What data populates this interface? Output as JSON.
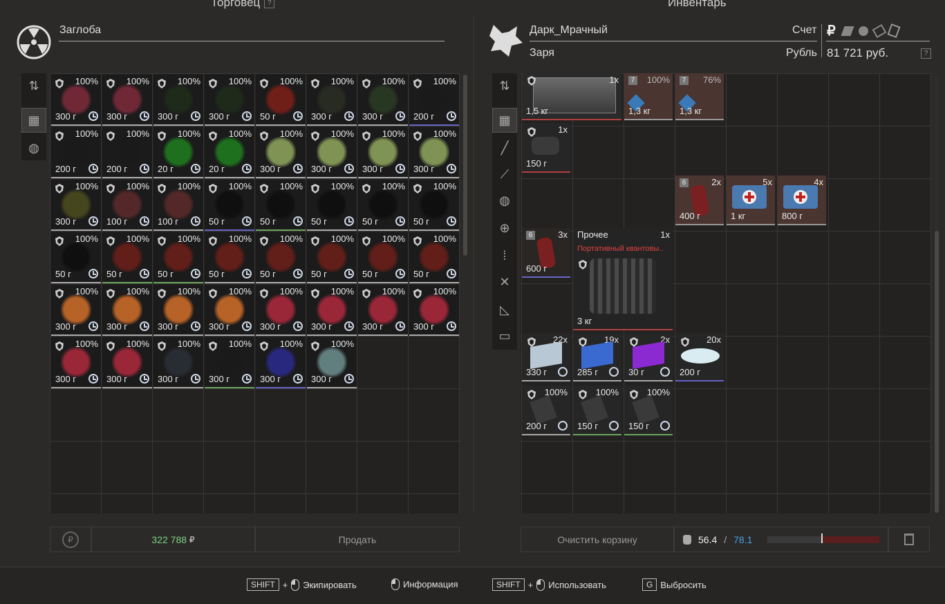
{
  "trader": {
    "panel_title": "Торговец",
    "help": "?",
    "name": "Заглоба",
    "total": "322 788",
    "currency_symbol": "₽",
    "sell_label": "Продать",
    "items": [
      {
        "pct": "100%",
        "w": "300 г",
        "c": "#7a2a3a",
        "q": ""
      },
      {
        "pct": "100%",
        "w": "300 г",
        "c": "#7a2a3a",
        "q": ""
      },
      {
        "pct": "100%",
        "w": "300 г",
        "c": "#1e2b1a",
        "q": ""
      },
      {
        "pct": "100%",
        "w": "300 г",
        "c": "#1e2b1a",
        "q": ""
      },
      {
        "pct": "100%",
        "w": "50 г",
        "c": "#7a1e18",
        "q": ""
      },
      {
        "pct": "100%",
        "w": "300 г",
        "c": "#2a2d22",
        "q": ""
      },
      {
        "pct": "100%",
        "w": "300 г",
        "c": "#2a3a22",
        "q": ""
      },
      {
        "pct": "100%",
        "w": "200 г",
        "c": "#1a1a1a",
        "q": "b"
      },
      {
        "pct": "100%",
        "w": "200 г",
        "c": "#1a1a1a",
        "q": ""
      },
      {
        "pct": "100%",
        "w": "200 г",
        "c": "#1a1a1a",
        "q": ""
      },
      {
        "pct": "100%",
        "w": "20 г",
        "c": "#1e7a1e",
        "q": ""
      },
      {
        "pct": "100%",
        "w": "20 г",
        "c": "#1e7a1e",
        "q": ""
      },
      {
        "pct": "100%",
        "w": "300 г",
        "c": "#8aa05a",
        "q": ""
      },
      {
        "pct": "100%",
        "w": "300 г",
        "c": "#8aa05a",
        "q": ""
      },
      {
        "pct": "100%",
        "w": "300 г",
        "c": "#8aa05a",
        "q": ""
      },
      {
        "pct": "100%",
        "w": "300 г",
        "c": "#8aa05a",
        "q": ""
      },
      {
        "pct": "100%",
        "w": "300 г",
        "c": "#4a4a1e",
        "q": ""
      },
      {
        "pct": "100%",
        "w": "100 г",
        "c": "#5a2a2a",
        "q": ""
      },
      {
        "pct": "100%",
        "w": "100 г",
        "c": "#5a2a2a",
        "q": ""
      },
      {
        "pct": "100%",
        "w": "50 г",
        "c": "#0e0e0e",
        "q": "b"
      },
      {
        "pct": "100%",
        "w": "50 г",
        "c": "#0e0e0e",
        "q": "g"
      },
      {
        "pct": "100%",
        "w": "50 г",
        "c": "#0e0e0e",
        "q": ""
      },
      {
        "pct": "100%",
        "w": "50 г",
        "c": "#0e0e0e",
        "q": ""
      },
      {
        "pct": "100%",
        "w": "50 г",
        "c": "#0e0e0e",
        "q": ""
      },
      {
        "pct": "100%",
        "w": "50 г",
        "c": "#0e0e0e",
        "q": ""
      },
      {
        "pct": "100%",
        "w": "50 г",
        "c": "#6a1e18",
        "q": "g"
      },
      {
        "pct": "100%",
        "w": "50 г",
        "c": "#6a1e18",
        "q": "g"
      },
      {
        "pct": "100%",
        "w": "50 г",
        "c": "#6a1e18",
        "q": ""
      },
      {
        "pct": "100%",
        "w": "50 г",
        "c": "#6a1e18",
        "q": ""
      },
      {
        "pct": "100%",
        "w": "50 г",
        "c": "#6a1e18",
        "q": ""
      },
      {
        "pct": "100%",
        "w": "50 г",
        "c": "#6a1e18",
        "q": ""
      },
      {
        "pct": "100%",
        "w": "50 г",
        "c": "#6a1e18",
        "q": ""
      },
      {
        "pct": "100%",
        "w": "300 г",
        "c": "#c86a28",
        "q": ""
      },
      {
        "pct": "100%",
        "w": "300 г",
        "c": "#c86a28",
        "q": ""
      },
      {
        "pct": "100%",
        "w": "300 г",
        "c": "#c86a28",
        "q": ""
      },
      {
        "pct": "100%",
        "w": "300 г",
        "c": "#c86a28",
        "q": ""
      },
      {
        "pct": "100%",
        "w": "300 г",
        "c": "#a8283a",
        "q": ""
      },
      {
        "pct": "100%",
        "w": "300 г",
        "c": "#a8283a",
        "q": ""
      },
      {
        "pct": "100%",
        "w": "300 г",
        "c": "#a8283a",
        "q": ""
      },
      {
        "pct": "100%",
        "w": "300 г",
        "c": "#a8283a",
        "q": ""
      },
      {
        "pct": "100%",
        "w": "300 г",
        "c": "#a8283a",
        "q": ""
      },
      {
        "pct": "100%",
        "w": "300 г",
        "c": "#a8283a",
        "q": ""
      },
      {
        "pct": "100%",
        "w": "300 г",
        "c": "#2a2e36",
        "q": ""
      },
      {
        "pct": "100%",
        "w": "300 г",
        "c": "#1a1a1a",
        "q": "g"
      },
      {
        "pct": "100%",
        "w": "300 г",
        "c": "#2a2a8a",
        "q": "b"
      },
      {
        "pct": "100%",
        "w": "300 г",
        "c": "#6a8a8a",
        "q": ""
      }
    ]
  },
  "inventory": {
    "panel_title": "Инвентарь",
    "player_name": "Дарк_Мрачный",
    "faction": "Заря",
    "account_label": "Счет",
    "currency_label": "Рубль",
    "balance": "81 721 руб.",
    "help": "?",
    "clear_cart_label": "Очистить корзину",
    "weight_current": "56.4",
    "weight_sep": "/",
    "weight_max": "78.1",
    "items": {
      "case": {
        "count": "1x",
        "w": "1,5 кг"
      },
      "crystal1": {
        "lvl": "7",
        "pct": "100%",
        "w": "1,3 кг"
      },
      "crystal2": {
        "lvl": "7",
        "pct": "76%",
        "w": "1,3 кг"
      },
      "device": {
        "count": "1x",
        "w": "150 г"
      },
      "bottle1": {
        "lvl": "6",
        "count": "2x",
        "w": "400 г"
      },
      "medkit1": {
        "count": "5x",
        "w": "1 кг"
      },
      "medkit2": {
        "count": "4x",
        "w": "800 г"
      },
      "bottle2": {
        "lvl": "6",
        "count": "3x",
        "w": "600 г"
      },
      "misc": {
        "title": "Прочее",
        "count": "1x",
        "subtitle": "Портативный квантовы..",
        "w": "3 кг"
      },
      "cube_white": {
        "count": "22x",
        "w": "330 г"
      },
      "cube_blue": {
        "count": "19x",
        "w": "285 г"
      },
      "cube_purple": {
        "count": "2x",
        "w": "30 г"
      },
      "powder": {
        "count": "20x",
        "w": "200 г"
      },
      "shard1": {
        "pct": "100%",
        "w": "200 г"
      },
      "shard2": {
        "pct": "100%",
        "w": "150 г"
      },
      "shard3": {
        "pct": "100%",
        "w": "150 г"
      }
    }
  },
  "hints": {
    "shift": "SHIFT",
    "plus": "+",
    "equip": "Экипировать",
    "info": "Информация",
    "use": "Использовать",
    "g_key": "G",
    "drop": "Выбросить"
  }
}
